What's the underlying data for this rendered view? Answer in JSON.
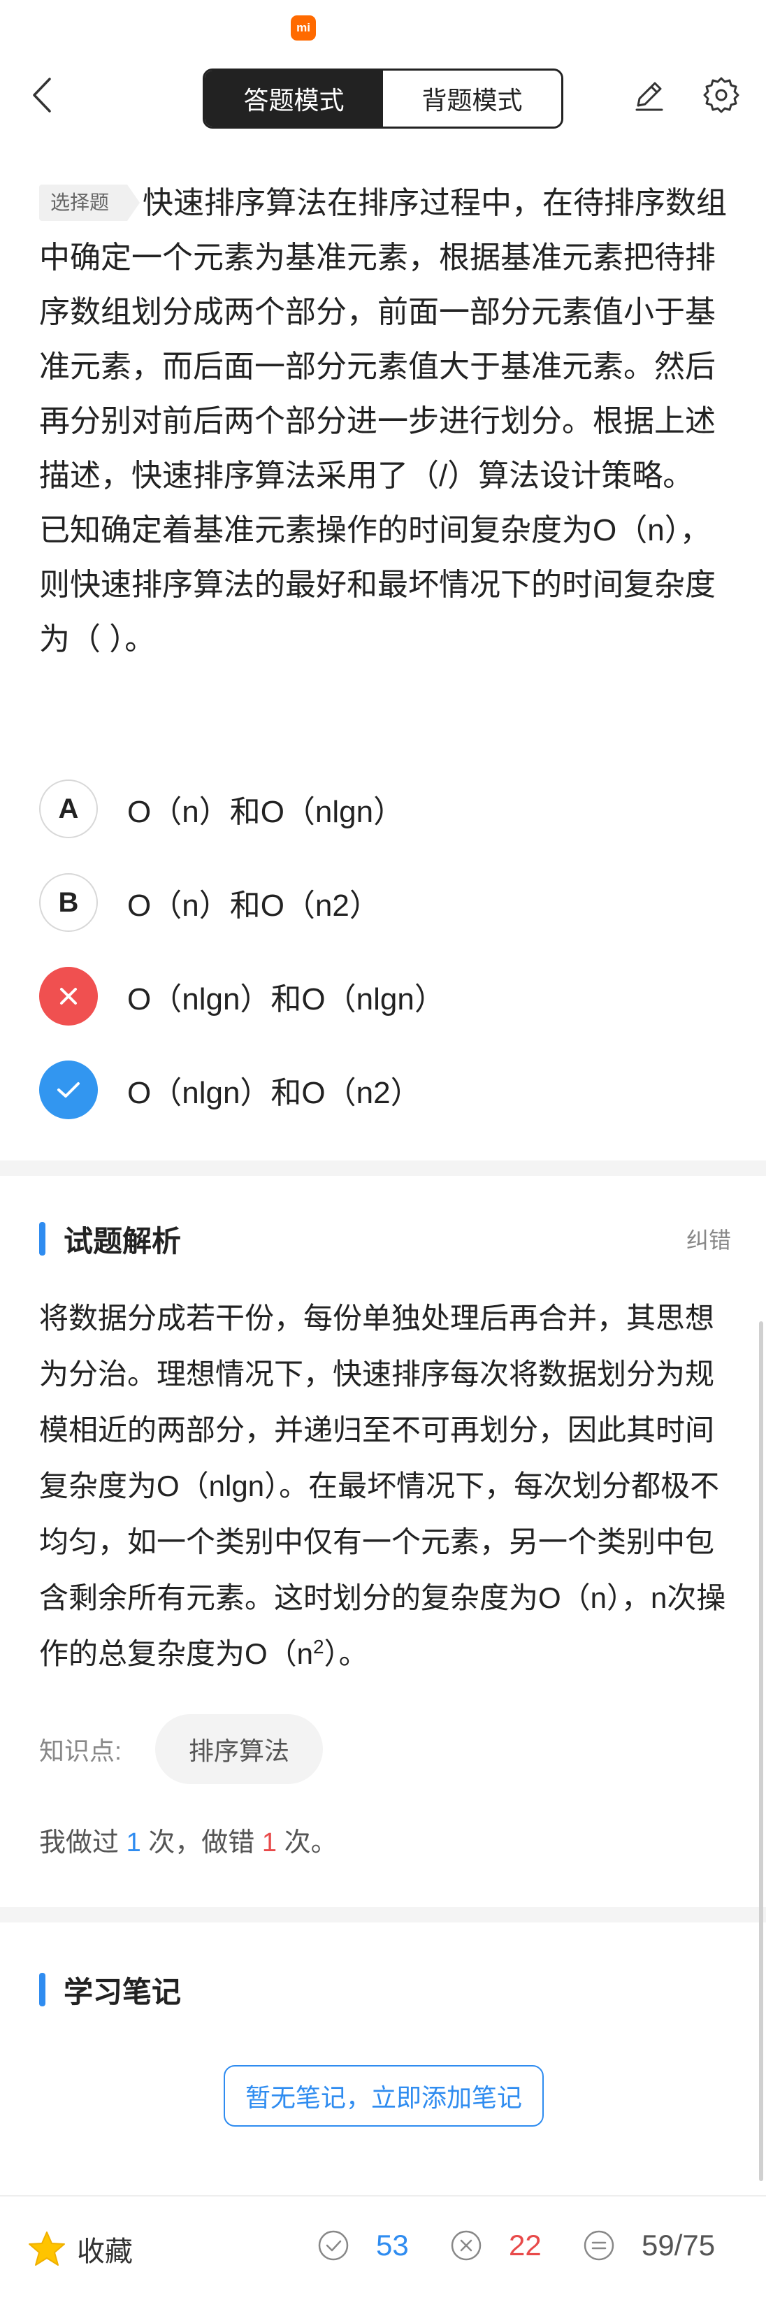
{
  "status_bar": {
    "mi_logo": "mi"
  },
  "header": {
    "modes": [
      "答题模式",
      "背题模式"
    ],
    "active_mode": 0,
    "icons": [
      "back-icon",
      "edit-icon",
      "gear-icon"
    ]
  },
  "question": {
    "type_tag": "选择题",
    "text": "快速排序算法在排序过程中，在待排序数组中确定一个元素为基准元素，根据基准元素把待排序数组划分成两个部分，前面一部分元素值小于基准元素，而后面一部分元素值大于基准元素。然后再分别对前后两个部分进一步进行划分。根据上述描述，快速排序算法采用了（/）算法设计策略。",
    "text2": "已知确定着基准元素操作的时间复杂度为O（n），则快速排序算法的最好和最坏情况下的时间复杂度为（ ）。"
  },
  "options": [
    {
      "letter": "A",
      "text": "O（n）和O（nlgn）",
      "state": "normal"
    },
    {
      "letter": "B",
      "text": "O（n）和O（n2）",
      "state": "normal"
    },
    {
      "letter": "",
      "text": "O（nlgn）和O（nlgn）",
      "state": "wrong"
    },
    {
      "letter": "",
      "text": "O（nlgn）和O（n2）",
      "state": "correct"
    }
  ],
  "analysis": {
    "title": "试题解析",
    "correct_link": "纠错",
    "body_main": "将数据分成若干份，每份单独处理后再合并，其思想为分治。理想情况下，快速排序每次将数据划分为规模相近的两部分，并递归至不可再划分，因此其时间复杂度为O（nlgn）。在最坏情况下，每次划分都极不均匀，如一个类别中仅有一个元素，另一个类别中包含剩余所有元素。这时划分的复杂度为O（n），n次操作的总复杂度为O（n",
    "body_sup": "2",
    "body_tail": "）。",
    "kp_label": "知识点:",
    "kp_chip": "排序算法",
    "history_prefix": "我做过",
    "history_done": "1",
    "history_mid": "次，做错",
    "history_wrong": "1",
    "history_suffix": "次。"
  },
  "notes": {
    "title": "学习笔记",
    "add_button": "暂无笔记，立即添加笔记"
  },
  "bottom_bar": {
    "favorite_label": "收藏",
    "correct_count": "53",
    "wrong_count": "22",
    "progress": "59/75"
  },
  "colors": {
    "accent_blue": "#2f8cf0",
    "wrong_red": "#f05050",
    "correct_blue": "#3296f0",
    "star_yellow": "#ffc400",
    "mi_orange": "#ff6a00"
  }
}
